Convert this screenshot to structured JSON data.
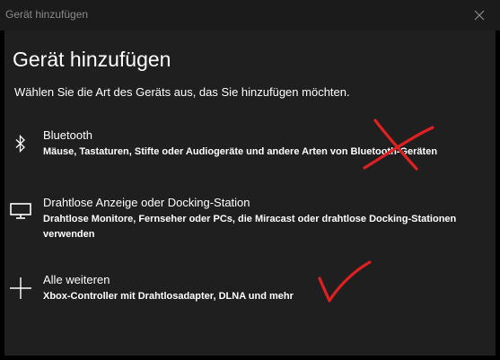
{
  "window": {
    "title": "Gerät hinzufügen"
  },
  "dialog": {
    "heading": "Gerät hinzufügen",
    "subtitle": "Wählen Sie die Art des Geräts aus, das Sie hinzufügen möchten.",
    "options": [
      {
        "icon": "bluetooth-icon",
        "title": "Bluetooth",
        "description": "Mäuse, Tastaturen, Stifte oder Audiogeräte und andere Arten von Bluetooth-Geräten"
      },
      {
        "icon": "monitor-icon",
        "title": "Drahtlose Anzeige oder Docking-Station",
        "description": "Drahtlose Monitore, Fernseher oder PCs, die Miracast oder drahtlose Docking-Stationen verwenden"
      },
      {
        "icon": "plus-icon",
        "title": "Alle weiteren",
        "description": "Xbox-Controller mit Drahtlosadapter, DLNA und mehr"
      }
    ]
  },
  "annotations": {
    "cross_mark": "red-cross-icon",
    "check_mark": "red-checkmark-icon",
    "color": "#e02020"
  },
  "colors": {
    "background": "#000000",
    "titlebar": "#1b1b1b",
    "content": "#1f1f1f",
    "title_text": "#8a8a8a",
    "text": "#ffffff"
  }
}
